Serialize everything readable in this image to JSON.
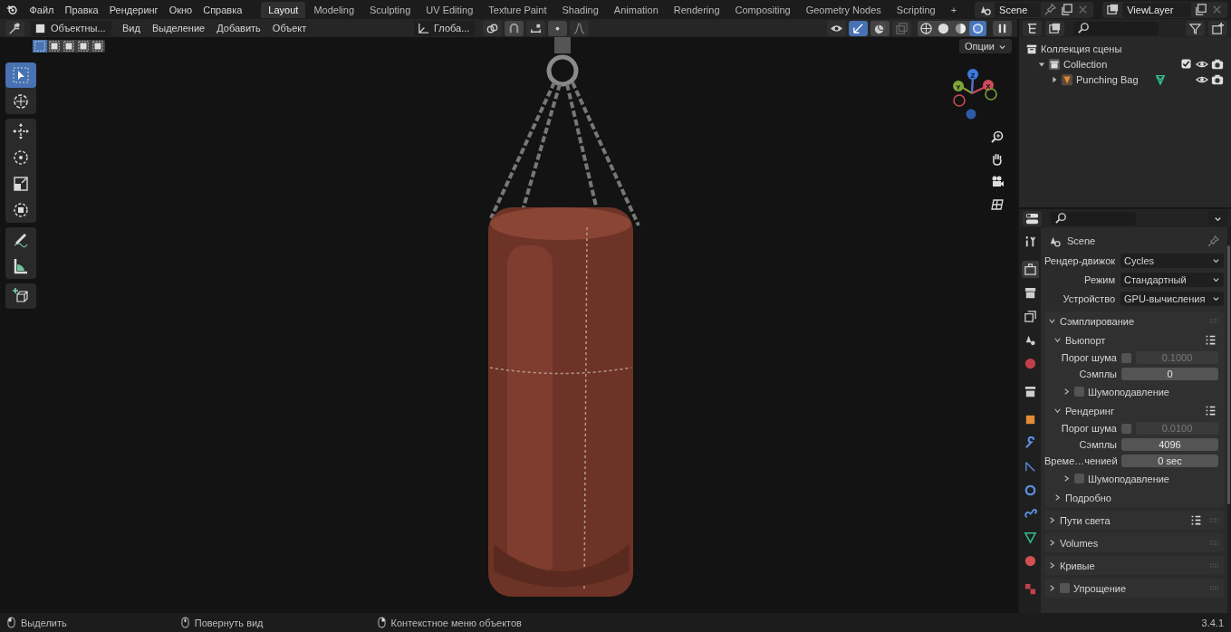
{
  "topbar": {
    "menus": [
      "Файл",
      "Правка",
      "Рендеринг",
      "Окно",
      "Справка"
    ],
    "workspaces": [
      {
        "label": "Layout",
        "selected": true
      },
      {
        "label": "Modeling",
        "selected": false
      },
      {
        "label": "Sculpting",
        "selected": false
      },
      {
        "label": "UV Editing",
        "selected": false
      },
      {
        "label": "Texture Paint",
        "selected": false
      },
      {
        "label": "Shading",
        "selected": false
      },
      {
        "label": "Animation",
        "selected": false
      },
      {
        "label": "Rendering",
        "selected": false
      },
      {
        "label": "Compositing",
        "selected": false
      },
      {
        "label": "Geometry Nodes",
        "selected": false
      },
      {
        "label": "Scripting",
        "selected": false
      }
    ],
    "add_tab": "+",
    "scene": "Scene",
    "view_layer": "ViewLayer"
  },
  "viewport": {
    "mode": "Объектны...",
    "menus": [
      "Вид",
      "Выделение",
      "Добавить",
      "Объект"
    ],
    "orientation": "Глоба...",
    "options": "Опции",
    "select_modes": [
      {
        "selected": true
      },
      {
        "selected": false
      },
      {
        "selected": false
      },
      {
        "selected": false
      },
      {
        "selected": false
      }
    ],
    "shading": [
      {
        "kind": "wire",
        "selected": false
      },
      {
        "kind": "solid",
        "selected": false
      },
      {
        "kind": "material",
        "selected": false
      },
      {
        "kind": "rendered",
        "selected": true
      }
    ],
    "tool_groups": [
      [
        {
          "kind": "select",
          "selected": true
        },
        {
          "kind": "cursor",
          "selected": false
        }
      ],
      [
        {
          "kind": "move",
          "selected": false
        },
        {
          "kind": "rotate",
          "selected": false
        },
        {
          "kind": "scale",
          "selected": false
        },
        {
          "kind": "transform",
          "selected": false
        }
      ],
      [
        {
          "kind": "annotate",
          "selected": false
        },
        {
          "kind": "measure",
          "selected": false
        }
      ],
      [
        {
          "kind": "add-cube",
          "selected": false
        }
      ]
    ],
    "gizmo": {
      "x": "X",
      "y": "Y",
      "z": "Z"
    }
  },
  "outliner": {
    "items": [
      {
        "kind": "scene",
        "label": "Коллекция сцены",
        "children": [
          {
            "kind": "collection",
            "label": "Collection",
            "expanded": true,
            "checked": true,
            "children": [
              {
                "kind": "object",
                "label": "Punching Bag",
                "expanded": false
              }
            ]
          }
        ]
      }
    ]
  },
  "properties": {
    "tabs": [
      {
        "kind": "tool",
        "selected": false
      },
      {
        "kind": "render",
        "selected": true
      },
      {
        "kind": "output",
        "selected": false
      },
      {
        "kind": "view-layer",
        "selected": false
      },
      {
        "kind": "scene",
        "selected": false
      },
      {
        "kind": "world",
        "selected": false
      },
      {
        "kind": "collection",
        "selected": false
      },
      {
        "kind": "object",
        "selected": false
      },
      {
        "kind": "modifier",
        "selected": false
      },
      {
        "kind": "particles",
        "selected": false
      },
      {
        "kind": "physics",
        "selected": false
      },
      {
        "kind": "constraints",
        "selected": false
      },
      {
        "kind": "data",
        "selected": false
      },
      {
        "kind": "material",
        "selected": false
      },
      {
        "kind": "texture",
        "selected": false
      }
    ],
    "context": "Scene",
    "fields": [
      {
        "label": "Рендер-движок",
        "value": "Cycles"
      },
      {
        "label": "Режим",
        "value": "Стандартный"
      },
      {
        "label": "Устройство",
        "value": "GPU-вычисления"
      }
    ],
    "panels": [
      {
        "title": "Сэмплирование",
        "expanded": true,
        "presets": false,
        "children": [
          {
            "title": "Вьюпорт",
            "expanded": true,
            "presets": true,
            "rows": [
              {
                "kind": "threshold",
                "label": "Порог шума",
                "checked": false,
                "value": "0.1000"
              },
              {
                "kind": "number",
                "label": "Сэмплы",
                "value": "0"
              }
            ],
            "children": [
              {
                "title": "Шумоподавление",
                "expanded": false,
                "checked": false
              }
            ]
          },
          {
            "title": "Рендеринг",
            "expanded": true,
            "presets": true,
            "rows": [
              {
                "kind": "threshold",
                "label": "Порог шума",
                "checked": false,
                "value": "0.0100"
              },
              {
                "kind": "number",
                "label": "Сэмплы",
                "value": "4096"
              },
              {
                "kind": "number",
                "label": "Време…ченией",
                "value": "0 sec"
              }
            ],
            "children": [
              {
                "title": "Шумоподавление",
                "expanded": false,
                "checked": false
              }
            ]
          },
          {
            "title": "Подробно",
            "expanded": false
          }
        ]
      },
      {
        "title": "Пути света",
        "expanded": false,
        "presets": true
      },
      {
        "title": "Volumes",
        "expanded": false
      },
      {
        "title": "Кривые",
        "expanded": false
      },
      {
        "title": "Упрощение",
        "expanded": false,
        "checked": false
      }
    ]
  },
  "status_bar": {
    "items": [
      {
        "kind": "left",
        "label": "Выделить"
      },
      {
        "kind": "middle",
        "label": "Повернуть вид"
      },
      {
        "kind": "right",
        "label": "Контекстное меню объектов"
      }
    ],
    "version": "3.4.1"
  }
}
